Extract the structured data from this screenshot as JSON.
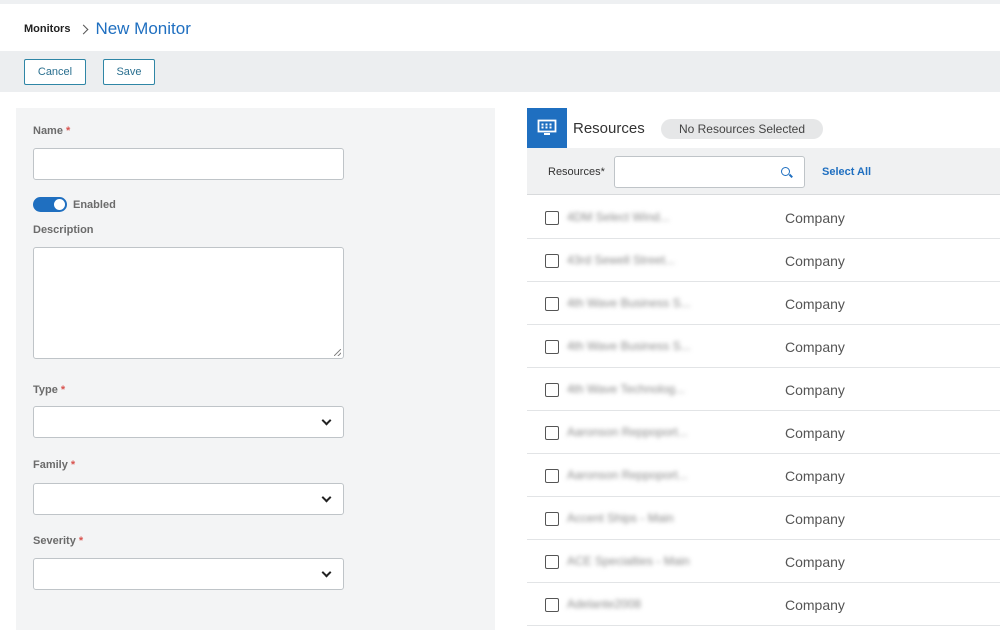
{
  "breadcrumb": {
    "root": "Monitors",
    "current": "New Monitor"
  },
  "toolbar": {
    "cancel_label": "Cancel",
    "save_label": "Save"
  },
  "form": {
    "name_label": "Name",
    "required_mark": "*",
    "enabled_label": "Enabled",
    "enabled": true,
    "description_label": "Description",
    "type_label": "Type",
    "family_label": "Family",
    "severity_label": "Severity"
  },
  "resources": {
    "title": "Resources",
    "badge": "No Resources Selected",
    "filter_label": "Resources*",
    "select_all": "Select All",
    "rows": [
      {
        "name": "4DM Select Wind...",
        "type": "Company"
      },
      {
        "name": "43rd Sewell Street...",
        "type": "Company"
      },
      {
        "name": "4th Wave Business S...",
        "type": "Company"
      },
      {
        "name": "4th Wave Business S...",
        "type": "Company"
      },
      {
        "name": "4th Wave Technolog...",
        "type": "Company"
      },
      {
        "name": "Aaronson Reppoport...",
        "type": "Company"
      },
      {
        "name": "Aaronson Reppoport...",
        "type": "Company"
      },
      {
        "name": "Accent Ships - Main",
        "type": "Company"
      },
      {
        "name": "ACE Specialties - Main",
        "type": "Company"
      },
      {
        "name": "Adelante2008",
        "type": "Company"
      }
    ]
  },
  "colors": {
    "accent": "#1f6fc0",
    "required": "#d9534f",
    "button_border": "#2f86a6"
  }
}
